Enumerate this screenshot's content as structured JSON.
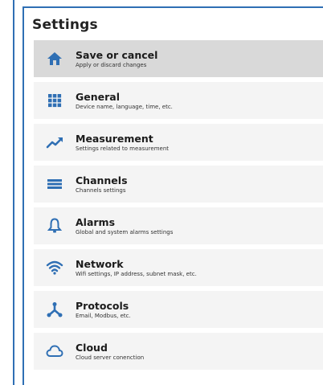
{
  "settings": {
    "title": "Settings",
    "accent_color": "#2f6fb4",
    "items": [
      {
        "label": "Save or cancel",
        "description": "Apply or discard changes",
        "icon": "home-icon",
        "active": true
      },
      {
        "label": "General",
        "description": "Device name, language, time, etc.",
        "icon": "grid-icon",
        "active": false
      },
      {
        "label": "Measurement",
        "description": "Settings related to measurement",
        "icon": "trend-icon",
        "active": false
      },
      {
        "label": "Channels",
        "description": "Channels settings",
        "icon": "list-icon",
        "active": false
      },
      {
        "label": "Alarms",
        "description": "Global and system alarms settings",
        "icon": "bell-icon",
        "active": false
      },
      {
        "label": "Network",
        "description": "Wifi settings, IP address, subnet mask, etc.",
        "icon": "wifi-icon",
        "active": false
      },
      {
        "label": "Protocols",
        "description": "Email, Modbus, etc.",
        "icon": "network-icon",
        "active": false
      },
      {
        "label": "Cloud",
        "description": "Cloud server conenction",
        "icon": "cloud-icon",
        "active": false
      }
    ]
  }
}
